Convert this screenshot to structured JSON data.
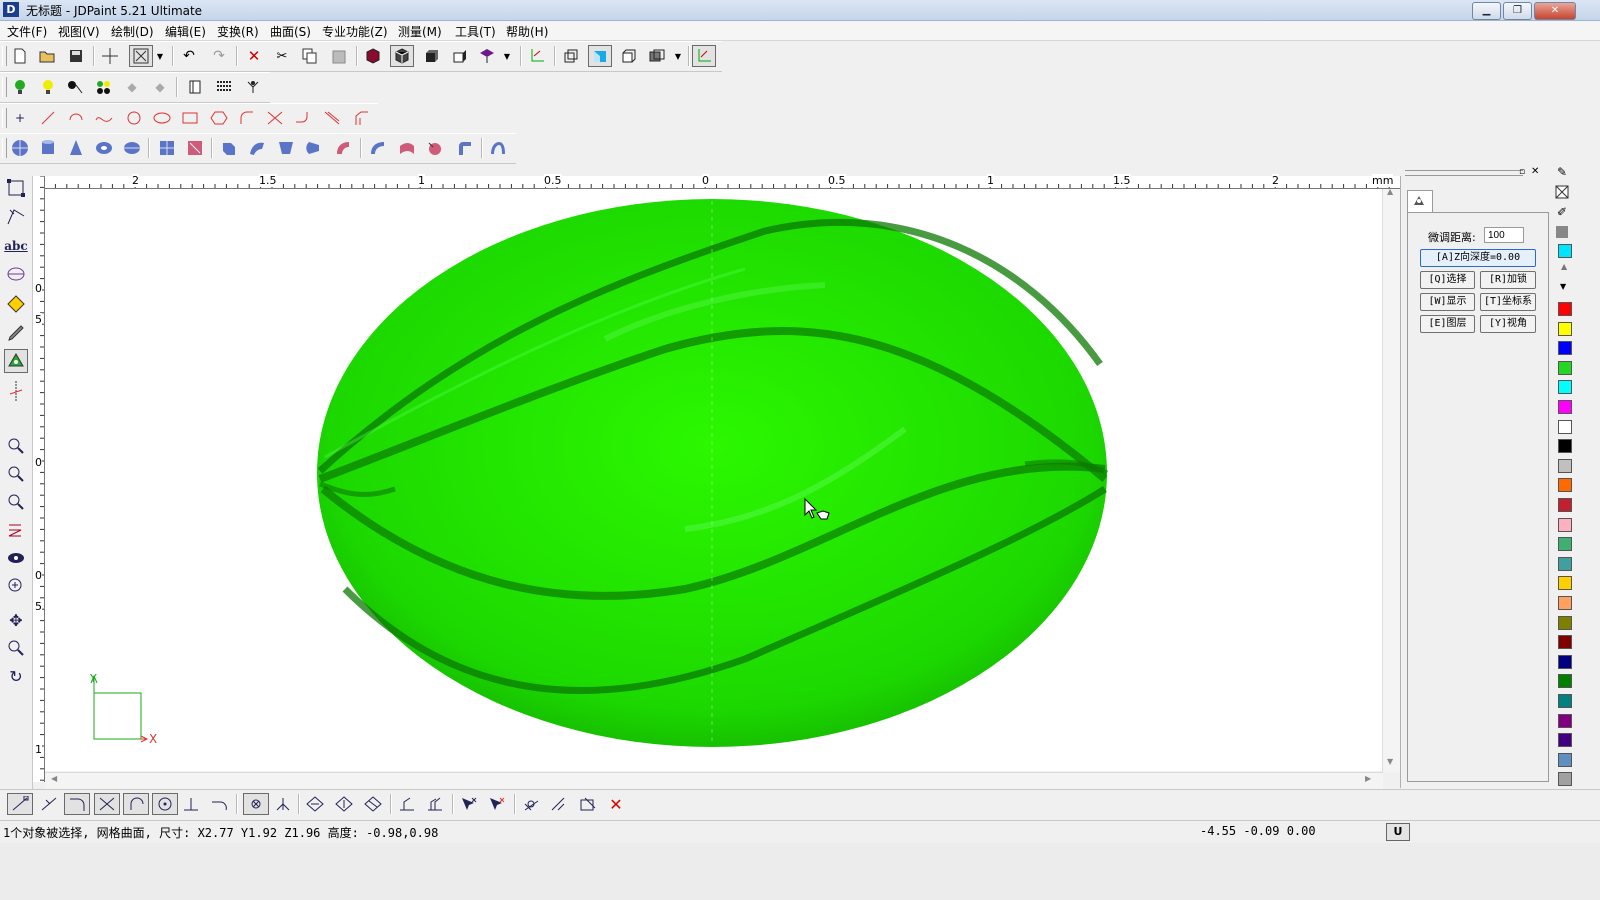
{
  "window": {
    "title": "无标题 - JDPaint 5.21 Ultimate",
    "logo_letter": "D",
    "controls": [
      "minimize-icon",
      "restore-icon",
      "close-icon"
    ]
  },
  "menu": [
    "文件(F)",
    "视图(V)",
    "绘制(D)",
    "编辑(E)",
    "变换(R)",
    "曲面(S)",
    "专业功能(Z)",
    "测量(M)",
    "工具(T)",
    "帮助(H)"
  ],
  "ruler": {
    "top_labels": [
      "2",
      "1.5",
      "1",
      "0.5",
      "0",
      "0.5",
      "1",
      "1.5",
      "2"
    ],
    "unit": "mm",
    "left_labels": [
      "0",
      "5",
      "0",
      "0",
      "5",
      "1"
    ]
  },
  "canvas": {
    "axis_x_label": "X",
    "axis_y_label": "Y",
    "surface_color": "#22ee00"
  },
  "right_panel": {
    "nudge_label": "微调距离:",
    "nudge_value": "100",
    "depth_button": "[A]Z向深度=0.00",
    "buttons": [
      [
        "[Q]选择",
        "[R]加锁"
      ],
      [
        "[W]显示",
        "[T]坐标系"
      ],
      [
        "[E]图层",
        "[Y]视角"
      ]
    ]
  },
  "palette": [
    "#00e5ff",
    "#ff0000",
    "#ffff00",
    "#0000ff",
    "#22d822",
    "#00ffff",
    "#ff00ff",
    "#ffffff",
    "#000000",
    "#c0c0c0",
    "#ff6a00",
    "#c02030",
    "#ffb0c0",
    "#40b070",
    "#40a0a0",
    "#ffd000",
    "#ffa060",
    "#808000",
    "#800000",
    "#000080",
    "#008000",
    "#008080",
    "#800080",
    "#400080",
    "#6090c0",
    "#a0a0a0"
  ],
  "status": {
    "selection_info": "1个对象被选择, 网格曲面, 尺寸: X2.77 Y1.92 Z1.96 高度: -0.98,0.98",
    "coordinates": "-4.55 -0.09 0.00",
    "mode_button": "U"
  }
}
